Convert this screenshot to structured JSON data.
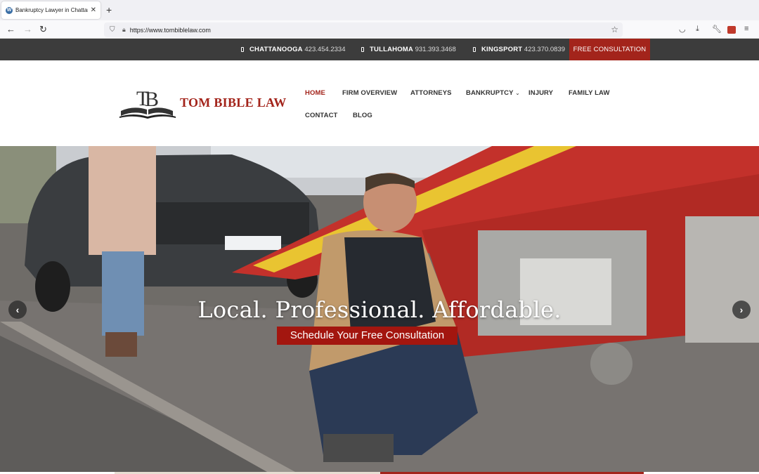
{
  "browser": {
    "tab_title": "Bankruptcy Lawyer in Chattanoo",
    "url": "https://www.tombiblelaw.com"
  },
  "infobar": {
    "locations": [
      {
        "city": "CHATTANOOGA",
        "phone": "423.454.2334"
      },
      {
        "city": "TULLAHOMA",
        "phone": "931.393.3468"
      },
      {
        "city": "KINGSPORT",
        "phone": "423.370.0839"
      }
    ],
    "cta": "FREE CONSULTATION"
  },
  "header": {
    "logo_text": "TOM BIBLE LAW",
    "menu": [
      {
        "label": "HOME"
      },
      {
        "label": "FIRM OVERVIEW"
      },
      {
        "label": "ATTORNEYS"
      },
      {
        "label": "BANKRUPTCY"
      },
      {
        "label": "INJURY"
      },
      {
        "label": "FAMILY LAW"
      },
      {
        "label": "CONTACT"
      },
      {
        "label": "BLOG"
      }
    ]
  },
  "hero": {
    "heading": "Local. Professional. Affordable.",
    "cta": "Schedule Your Free Consultation"
  },
  "colors": {
    "brand_red": "#a3241b",
    "infobar_bg": "#3c3c3c"
  }
}
